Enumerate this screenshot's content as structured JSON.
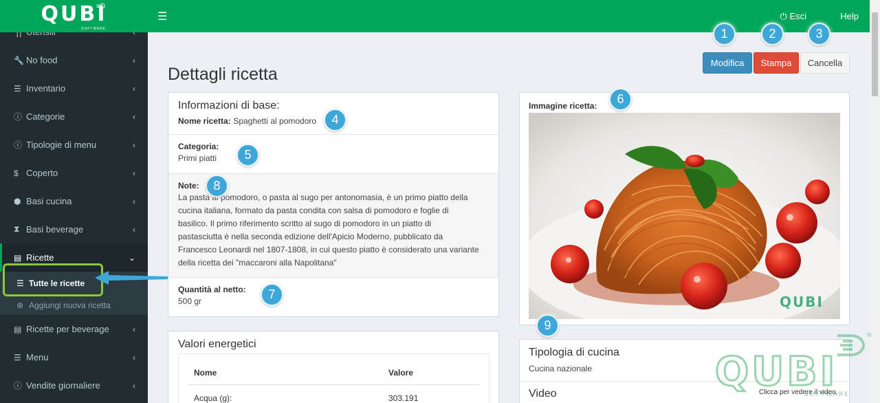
{
  "brand": {
    "logo_text": "QUBI",
    "logo_sub": "SOFTWARE"
  },
  "topbar": {
    "menu_icon": "hamburger-icon",
    "logout_label": "Esci",
    "help_label": "Help"
  },
  "sidebar": {
    "items": [
      {
        "label": "Utensili",
        "icon": "utensils-icon"
      },
      {
        "label": "No food",
        "icon": "wrench-icon"
      },
      {
        "label": "Inventario",
        "icon": "list-icon"
      },
      {
        "label": "Categorie",
        "icon": "info-icon"
      },
      {
        "label": "Tipologie di menu",
        "icon": "info-icon"
      },
      {
        "label": "Coperto",
        "icon": "dollar-icon"
      },
      {
        "label": "Basi cucina",
        "icon": "cube-icon"
      },
      {
        "label": "Basi beverage",
        "icon": "hourglass-icon"
      },
      {
        "label": "Ricette",
        "icon": "file-icon"
      },
      {
        "label": "Ricette per beverage",
        "icon": "file-icon"
      },
      {
        "label": "Menu",
        "icon": "list-icon"
      },
      {
        "label": "Vendite giornaliere",
        "icon": "info-icon"
      }
    ],
    "submenu": [
      {
        "label": "Tutte le ricette",
        "icon": "list-icon"
      },
      {
        "label": "Aggiungi nuova ricetta",
        "icon": "plus-circle-icon"
      }
    ]
  },
  "page": {
    "title": "Dettagli ricetta",
    "buttons": {
      "edit": "Modifica",
      "print": "Stampa",
      "cancel": "Cancella"
    }
  },
  "basic_info": {
    "heading": "Informazioni di base:",
    "name_label": "Nome ricetta:",
    "name_value": "Spaghetti al pomodoro",
    "category_label": "Categoria:",
    "category_value": "Primi piatti",
    "notes_label": "Note:",
    "notes_lines": [
      "La pasta al pomodoro, o pasta al sugo per antonomasia, è un primo piatto della",
      "cucina italiana, formato da pasta condita con salsa di pomodoro e foglie di",
      "basilico. Il primo riferimento scritto al sugo di pomodoro in un piatto di",
      "pastasciutta è nella seconda edizione dell'Apicio Moderno, pubblicato da",
      "Francesco Leonardi nel 1807-1808, in cui questo piatto è considerato una variante",
      "della ricetta dei \"maccaroni alla Napolitana\""
    ],
    "qty_label": "Quantità al netto:",
    "qty_value": "500 gr"
  },
  "image_box": {
    "label": "Immagine ricetta:",
    "photo_watermark": "QUBI"
  },
  "energy": {
    "title": "Valori energetici",
    "col_name": "Nome",
    "col_value": "Valore",
    "rows": [
      {
        "name": "Acqua (g):",
        "value": "303.191"
      }
    ]
  },
  "cuisine": {
    "title": "Tipologia di cucina",
    "value": "Cucina nazionale",
    "video_title": "Video",
    "video_hint": "Clicca per vedere il video."
  },
  "callouts": [
    "1",
    "2",
    "3",
    "4",
    "5",
    "6",
    "7",
    "8",
    "9"
  ],
  "colors": {
    "brand_green": "#00a65a",
    "sidebar_bg": "#222d32",
    "edit_blue": "#3c8dbc",
    "print_red": "#dd4b39",
    "callout_blue": "#3da7d8",
    "highlight_green": "#8dc63f"
  }
}
